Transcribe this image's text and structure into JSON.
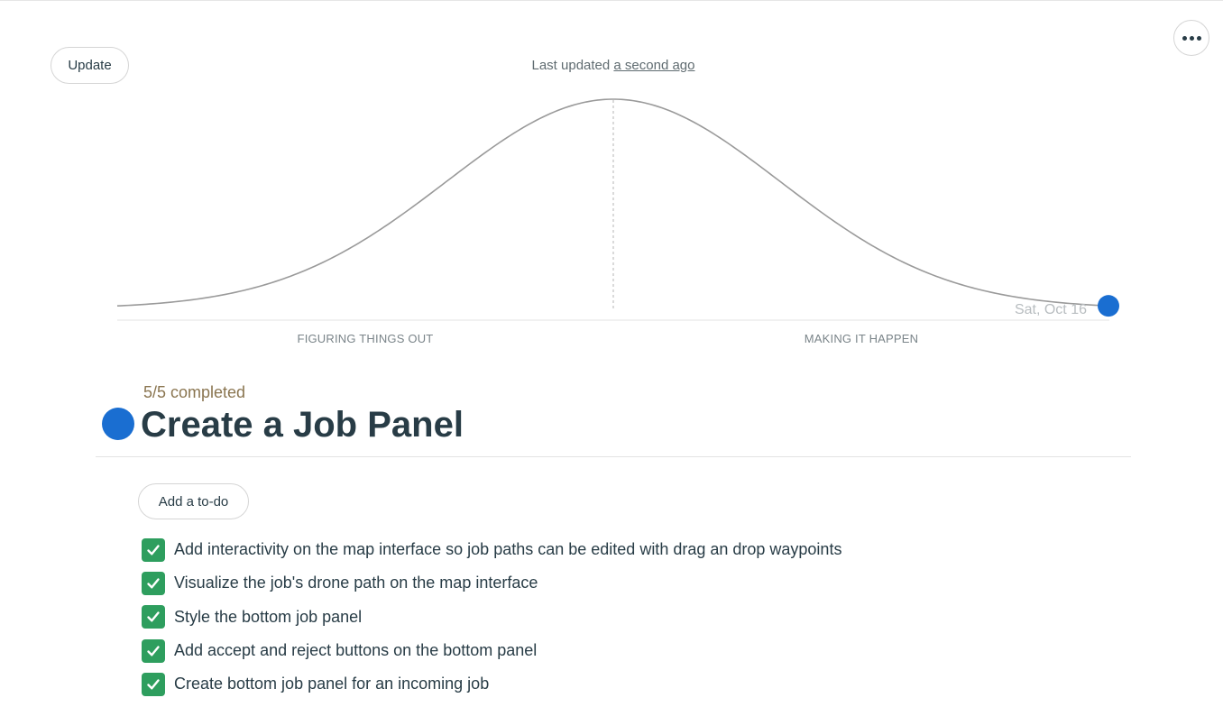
{
  "toolbar": {
    "update_label": "Update",
    "more_icon": "more-horizontal-icon"
  },
  "status": {
    "last_updated_prefix": "Last updated",
    "last_updated_link": "a second ago"
  },
  "hill_chart": {
    "left_phase": "FIGURING THINGS OUT",
    "right_phase": "MAKING IT HAPPEN",
    "marker_date": "Sat, Oct 16",
    "marker_color": "#1a6ed1",
    "curve_color": "#9a9a9a",
    "marker_progress": 1.0
  },
  "scope": {
    "completed_text": "5/5 completed",
    "title": "Create a Job Panel",
    "dot_color": "#1a6ed1"
  },
  "todos": {
    "add_label": "Add a to-do",
    "check_color": "#2e9e5e",
    "items": [
      {
        "label": "Add interactivity on the map interface so job paths can be edited with drag an drop waypoints",
        "done": true
      },
      {
        "label": "Visualize the job's drone path on the map interface",
        "done": true
      },
      {
        "label": "Style the bottom job panel",
        "done": true
      },
      {
        "label": "Add accept and reject buttons on the bottom panel",
        "done": true
      },
      {
        "label": "Create bottom job panel for an incoming job",
        "done": true
      }
    ]
  }
}
